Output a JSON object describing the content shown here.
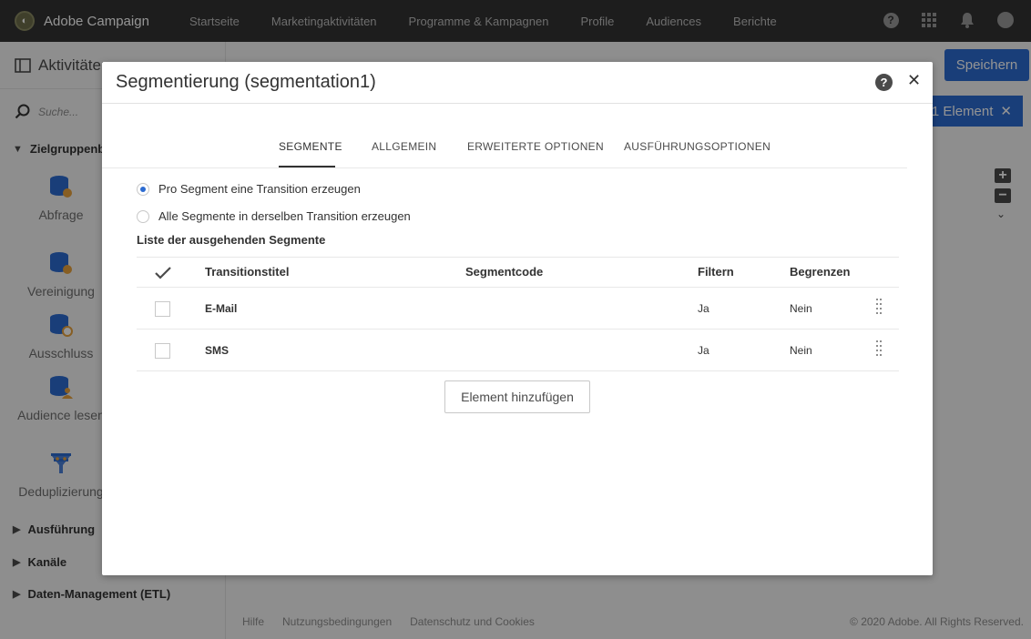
{
  "app": {
    "name": "Adobe Campaign"
  },
  "topnav": {
    "links": [
      "Startseite",
      "Marketingaktivitäten",
      "Programme & Kampagnen",
      "Profile",
      "Audiences",
      "Berichte"
    ],
    "icons": [
      "help-icon",
      "apps-grid-icon",
      "notifications-bell-icon",
      "user-avatar-icon"
    ]
  },
  "sidebar": {
    "title": "Aktivitäten",
    "search_placeholder": "Suche...",
    "category_open": "Zielgruppenbestimmung",
    "activities": [
      {
        "label": "Abfrage",
        "icon": "query-icon"
      },
      {
        "label": "Vereinigung",
        "icon": "union-icon"
      },
      {
        "label": "Ausschluss",
        "icon": "exclusion-icon"
      },
      {
        "label": "Audience lesen",
        "icon": "read-audience-icon"
      },
      {
        "label": "Deduplizierung",
        "icon": "deduplication-icon"
      }
    ],
    "categories_closed": [
      "Ausführung",
      "Kanäle",
      "Daten-Management (ETL)"
    ]
  },
  "toolbar": {
    "save_label": "Speichern",
    "selection_label": "1 Element"
  },
  "footer": {
    "links": [
      "Hilfe",
      "Nutzungsbedingungen",
      "Datenschutz und Cookies"
    ],
    "copyright": "© 2020 Adobe. All Rights Reserved."
  },
  "modal": {
    "title": "Segmentierung (segmentation1)",
    "tabs": [
      "SEGMENTE",
      "ALLGEMEIN",
      "ERWEITERTE OPTIONEN",
      "AUSFÜHRUNGSOPTIONEN"
    ],
    "active_tab": "SEGMENTE",
    "radio_options": [
      {
        "label": "Pro Segment eine Transition erzeugen",
        "checked": true
      },
      {
        "label": "Alle Segmente in derselben Transition erzeugen",
        "checked": false
      }
    ],
    "list_title": "Liste der ausgehenden Segmente",
    "table": {
      "headers": [
        "Transitionstitel",
        "Segmentcode",
        "Filtern",
        "Begrenzen"
      ],
      "rows": [
        {
          "title": "E-Mail",
          "code": "",
          "filter": "Ja",
          "limit": "Nein"
        },
        {
          "title": "SMS",
          "code": "",
          "filter": "Ja",
          "limit": "Nein"
        }
      ]
    },
    "add_button_label": "Element hinzufügen"
  },
  "colors": {
    "accent": "#2c6bd1",
    "topbar": "#323232"
  }
}
